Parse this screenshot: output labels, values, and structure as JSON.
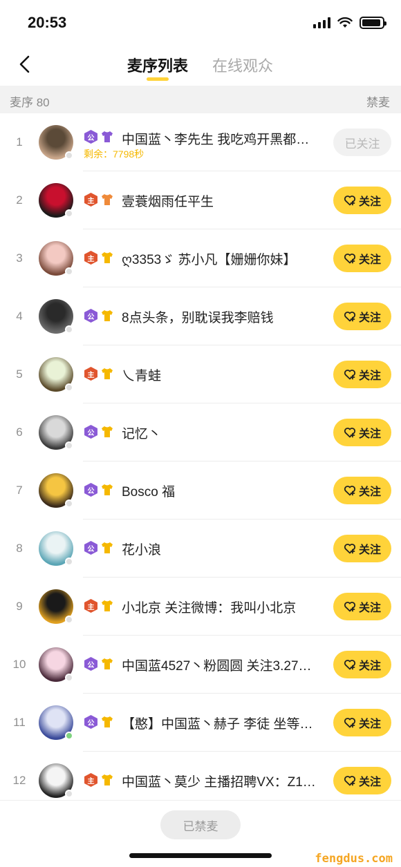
{
  "status_bar": {
    "time": "20:53"
  },
  "nav": {
    "back_icon": "chevron-left-icon",
    "tabs": [
      {
        "label": "麦序列表",
        "active": true
      },
      {
        "label": "在线观众",
        "active": false
      }
    ]
  },
  "subheader": {
    "queue_label": "麦序 80",
    "mute_label": "禁麦"
  },
  "colors": {
    "accent": "#ffd33a",
    "remain_text": "#f5b800",
    "badge_purple": "#8a5ad6",
    "badge_red": "#e0552e"
  },
  "rows": [
    {
      "index": "1",
      "name": "中国蓝丶李先生 我吃鸡开黑都…",
      "role": "公",
      "role_color": "purple",
      "shirt_color": "#8a5ad6",
      "remain": "剩余：7798秒",
      "button": "已关注",
      "followed": true,
      "avatar": [
        "#5b4a38",
        "#c9a68a"
      ],
      "online": false
    },
    {
      "index": "2",
      "name": "壹蓑烟雨任平生",
      "role": "主",
      "role_color": "red",
      "shirt_color": "#ef8a3a",
      "button": "关注",
      "followed": false,
      "avatar": [
        "#c8102e",
        "#1a1a1a"
      ],
      "online": false
    },
    {
      "index": "3",
      "name": "ღ3353ゞ 苏小凡【姗姗你妹】",
      "role": "主",
      "role_color": "red",
      "shirt_color": "#f5b800",
      "button": "关注",
      "followed": false,
      "avatar": [
        "#f3c9c2",
        "#7a4a3a"
      ],
      "online": false
    },
    {
      "index": "4",
      "name": "8点头条，别耽误我李赔钱",
      "role": "公",
      "role_color": "purple",
      "shirt_color": "#f5b800",
      "button": "关注",
      "followed": false,
      "avatar": [
        "#2a2a2a",
        "#6b6b6b"
      ],
      "online": false
    },
    {
      "index": "5",
      "name": "乀青蛙",
      "role": "主",
      "role_color": "red",
      "shirt_color": "#f5b800",
      "button": "关注",
      "followed": false,
      "avatar": [
        "#e9f2d6",
        "#5a4a2a"
      ],
      "online": false
    },
    {
      "index": "6",
      "name": "记忆丶",
      "role": "公",
      "role_color": "purple",
      "shirt_color": "#f5b800",
      "button": "关注",
      "followed": false,
      "avatar": [
        "#d9d9d9",
        "#3a3a3a"
      ],
      "online": false
    },
    {
      "index": "7",
      "name": "Bosco 福",
      "role": "公",
      "role_color": "purple",
      "shirt_color": "#f5b800",
      "button": "关注",
      "followed": false,
      "avatar": [
        "#f5c542",
        "#3a2a1a"
      ],
      "online": false
    },
    {
      "index": "8",
      "name": "花小浪",
      "role": "公",
      "role_color": "purple",
      "shirt_color": "#f5b800",
      "button": "关注",
      "followed": false,
      "avatar": [
        "#eaf3f4",
        "#5aa5b5"
      ],
      "online": false
    },
    {
      "index": "9",
      "name": "小北京 关注微博：我叫小北京",
      "role": "主",
      "role_color": "red",
      "shirt_color": "#f5b800",
      "button": "关注",
      "followed": false,
      "avatar": [
        "#1a1a1a",
        "#e0a020"
      ],
      "online": false
    },
    {
      "index": "10",
      "name": "中国蓝4527丶粉圆圆 关注3.27…",
      "role": "公",
      "role_color": "purple",
      "shirt_color": "#f5b800",
      "button": "关注",
      "followed": false,
      "avatar": [
        "#f6d6e2",
        "#4a2a3a"
      ],
      "online": false
    },
    {
      "index": "11",
      "name": "【憨】中国蓝丶赫子 李徒 坐等…",
      "role": "公",
      "role_color": "purple",
      "shirt_color": "#f5b800",
      "button": "关注",
      "followed": false,
      "avatar": [
        "#dfe3f5",
        "#3a4a9a"
      ],
      "online": true
    },
    {
      "index": "12",
      "name": "中国蓝丶莫少 主播招聘VX：Z1…",
      "role": "主",
      "role_color": "red",
      "shirt_color": "#f5b800",
      "button": "关注",
      "followed": false,
      "avatar": [
        "#f4f4f4",
        "#222222"
      ],
      "online": false
    }
  ],
  "bottom": {
    "ban_button": "已禁麦",
    "watermark": "fengdus.com"
  }
}
